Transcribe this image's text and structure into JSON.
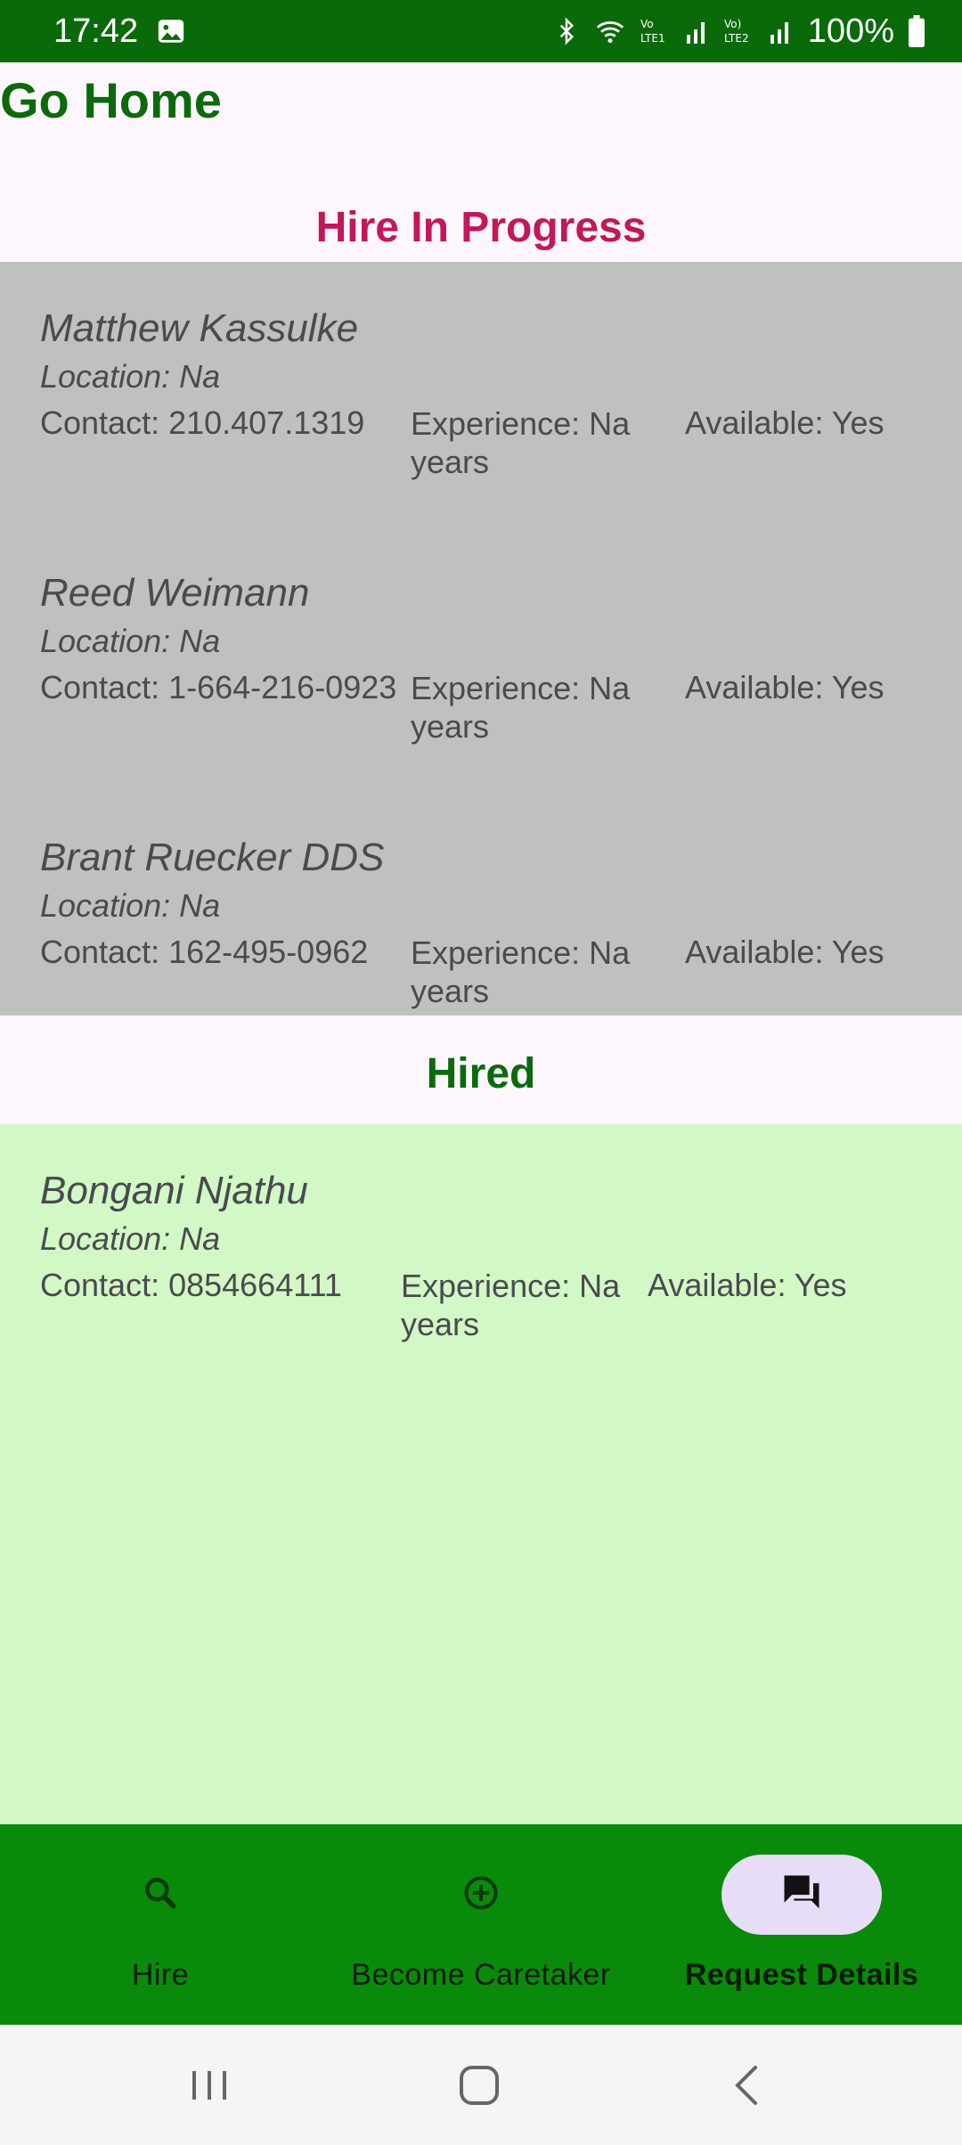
{
  "status_bar": {
    "time": "17:42",
    "battery_text": "100%",
    "icons": [
      "image-icon",
      "bluetooth-icon",
      "wifi-icon",
      "signal-lte1-icon",
      "signal-lte2-icon",
      "battery-icon"
    ],
    "lte1_label": "Vo LTE1",
    "lte2_label": "Vo) LTE2"
  },
  "header": {
    "title": "Go Home"
  },
  "sections": {
    "in_progress": {
      "title": "Hire In Progress",
      "cards": [
        {
          "name": "Matthew Kassulke",
          "location": "Location: Na",
          "contact": "Contact: 210.407.1319",
          "experience": "Experience: Na years",
          "available": "Available: Yes"
        },
        {
          "name": "Reed Weimann",
          "location": "Location: Na",
          "contact": "Contact: 1-664-216-0923",
          "experience": "Experience: Na years",
          "available": "Available: Yes"
        },
        {
          "name": "Brant Ruecker DDS",
          "location": "Location: Na",
          "contact": "Contact: 162-495-0962",
          "experience": "Experience: Na years",
          "available": "Available: Yes"
        }
      ]
    },
    "hired": {
      "title": "Hired",
      "cards": [
        {
          "name": "Bongani Njathu",
          "location": "Location: Na",
          "contact": "Contact: 0854664111",
          "experience": "Experience: Na years",
          "available": "Available: Yes"
        }
      ]
    }
  },
  "bottom_nav": {
    "items": [
      {
        "label": "Hire",
        "icon": "search-icon",
        "active": false
      },
      {
        "label": "Become Caretaker",
        "icon": "add-circle-icon",
        "active": false
      },
      {
        "label": "Request Details",
        "icon": "chat-icon",
        "active": true
      }
    ]
  },
  "colors": {
    "status_bar": "#0a6a0a",
    "title_green": "#0c6a0c",
    "in_progress_title": "#c2185b",
    "in_progress_bg": "#bec1bd",
    "hired_bg": "#d2f8c6",
    "bottom_nav_bg": "#0a8a0a",
    "active_pill": "#e8ddf7"
  }
}
